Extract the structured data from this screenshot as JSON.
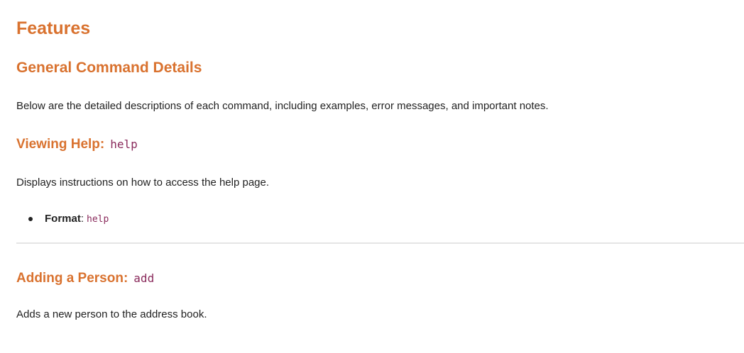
{
  "title": "Features",
  "section": {
    "heading": "General Command Details",
    "intro": "Below are the detailed descriptions of each command, including examples, error messages, and important notes."
  },
  "commands": [
    {
      "heading": "Viewing Help:",
      "command": "help",
      "description": "Displays instructions on how to access the help page.",
      "format_label": "Format",
      "format_sep": ":",
      "format_value": "help"
    },
    {
      "heading": "Adding a Person:",
      "command": "add",
      "description": "Adds a new person to the address book."
    }
  ],
  "colors": {
    "heading": "#d9722f",
    "code": "#8a2b5c",
    "text": "#222222"
  }
}
